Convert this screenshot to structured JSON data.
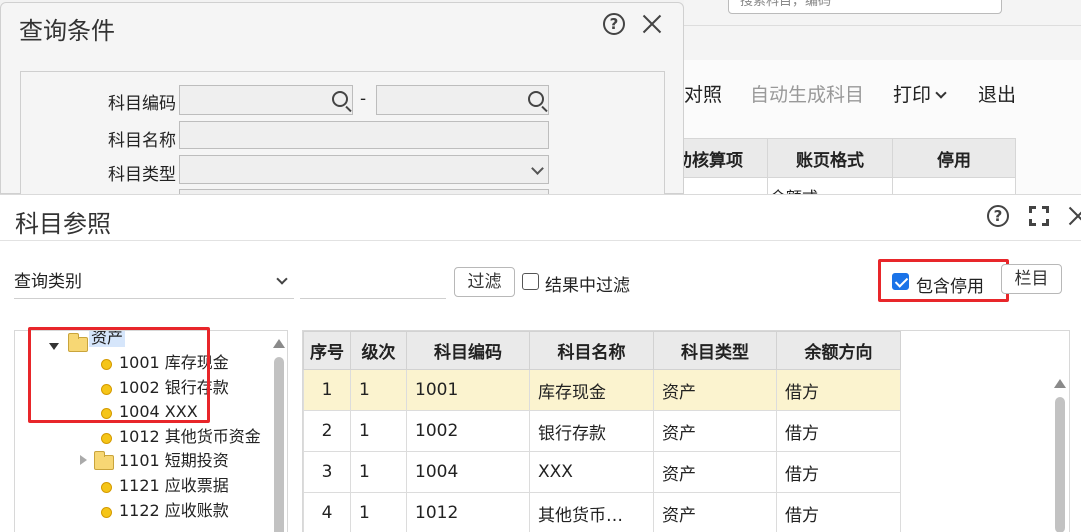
{
  "background": {
    "search_placeholder": "搜索科目，编码",
    "toolbar": [
      {
        "label": "对照",
        "disabled": false,
        "menu": false
      },
      {
        "label": "自动生成科目",
        "disabled": true,
        "menu": false
      },
      {
        "label": "打印",
        "disabled": false,
        "menu": true
      },
      {
        "label": "退出",
        "disabled": false,
        "menu": false
      }
    ],
    "headers": [
      "助核算项",
      "账页格式",
      "停用"
    ],
    "partial_cell": "余额式"
  },
  "query_dialog": {
    "title": "查询条件",
    "fields": {
      "code_label": "科目编码",
      "code_from": "",
      "range_sep": "-",
      "code_to": "",
      "name_label": "科目名称",
      "name_value": "",
      "type_label": "科目类型",
      "type_value": ""
    }
  },
  "ref_dialog": {
    "title": "科目参照",
    "query_category": "查询类别",
    "filter_input": "",
    "filter_button": "过滤",
    "filter_in_result": {
      "label": "结果中过滤",
      "checked": false
    },
    "include_disabled": {
      "label": "包含停用",
      "checked": true
    },
    "columns_button": "栏目",
    "tree": [
      {
        "label": "资产",
        "type": "folder",
        "expanded": true,
        "selected": true,
        "level": 0
      },
      {
        "label": "1001 库存现金",
        "type": "leaf",
        "level": 1
      },
      {
        "label": "1002 银行存款",
        "type": "leaf",
        "level": 1
      },
      {
        "label": "1004 XXX",
        "type": "leaf",
        "level": 1
      },
      {
        "label": "1012 其他货币资金",
        "type": "leaf",
        "level": 1
      },
      {
        "label": "1101 短期投资",
        "type": "folder",
        "expanded": false,
        "level": 1
      },
      {
        "label": "1121 应收票据",
        "type": "leaf",
        "level": 1
      },
      {
        "label": "1122 应收账款",
        "type": "leaf",
        "level": 1
      }
    ],
    "table": {
      "columns": [
        "序号",
        "级次",
        "科目编码",
        "科目名称",
        "科目类型",
        "余额方向"
      ],
      "rows": [
        {
          "seq": "1",
          "level": "1",
          "code": "1001",
          "name": "库存现金",
          "type": "资产",
          "direction": "借方",
          "selected": true
        },
        {
          "seq": "2",
          "level": "1",
          "code": "1002",
          "name": "银行存款",
          "type": "资产",
          "direction": "借方"
        },
        {
          "seq": "3",
          "level": "1",
          "code": "1004",
          "name": "XXX",
          "type": "资产",
          "direction": "借方"
        },
        {
          "seq": "4",
          "level": "1",
          "code": "1012",
          "name": "其他货币…",
          "type": "资产",
          "direction": "借方"
        }
      ]
    }
  }
}
